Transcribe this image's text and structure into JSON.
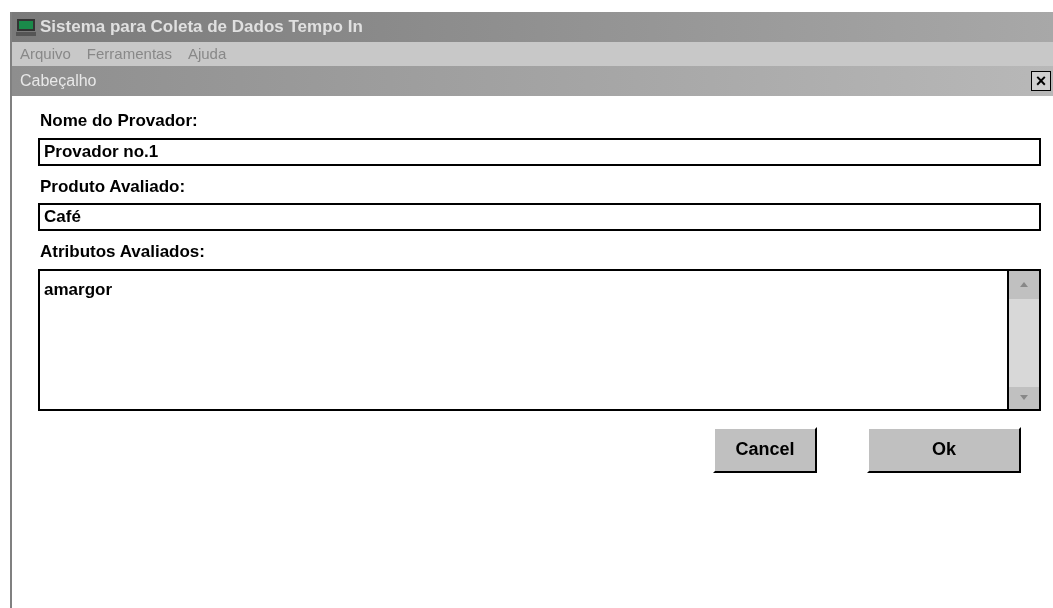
{
  "window": {
    "title": "Sistema para Coleta de Dados Tempo In"
  },
  "menu": [
    "Arquivo",
    "Ferramentas",
    "Ajuda"
  ],
  "dialog": {
    "title": "Cabeçalho",
    "close": "×",
    "fields": [
      {
        "label": "Nome do Provador:",
        "value": "Provador no.1"
      },
      {
        "label": "Produto Avaliado:",
        "value": "Café"
      }
    ],
    "list": {
      "label": "Atributos Avaliados:",
      "items": [
        "amargor"
      ]
    },
    "buttons": [
      "Cancel",
      "Ok"
    ]
  }
}
